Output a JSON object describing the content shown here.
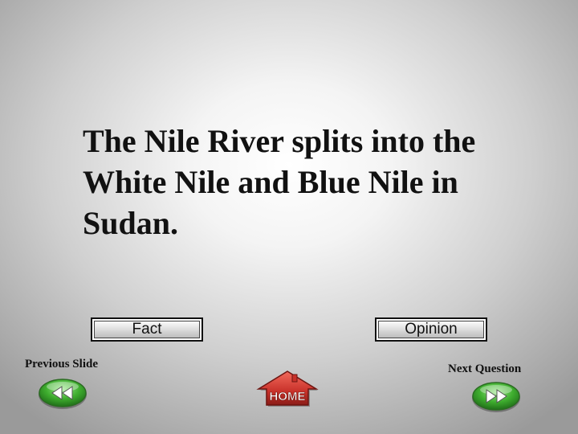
{
  "slide": {
    "question": "The Nile River splits into the White Nile and Blue Nile in Sudan."
  },
  "answers": {
    "fact_label": "Fact",
    "opinion_label": "Opinion"
  },
  "navigation": {
    "previous_label": "Previous Slide",
    "next_label": "Next Question",
    "home_label": "HOME"
  },
  "icons": {
    "previous": "rewind-arrows-icon",
    "next": "forward-arrows-icon",
    "home": "house-icon"
  },
  "colors": {
    "nav_green": "#3fae2f",
    "home_red": "#c8312a"
  }
}
